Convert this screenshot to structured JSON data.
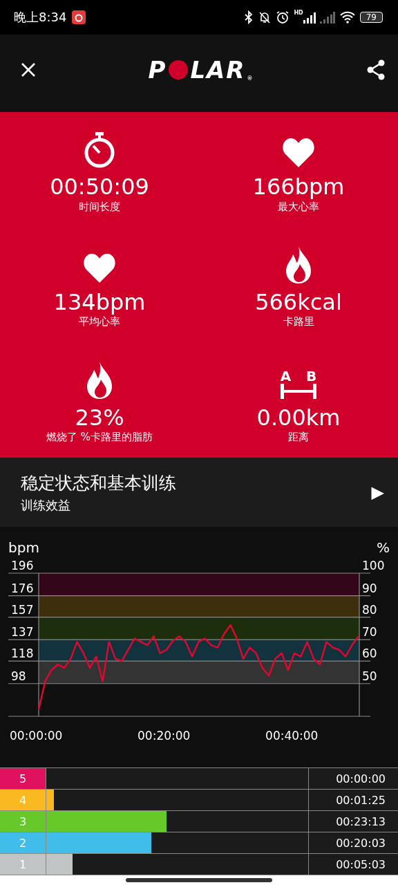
{
  "status_bar": {
    "time": "晚上8:34",
    "network": "HD",
    "battery": "79"
  },
  "header": {
    "logo": {
      "before": "P",
      "after": "LAR",
      "mark": "®"
    }
  },
  "stats": [
    {
      "kind": "stopwatch",
      "value": "00:50:09",
      "label": "时间长度"
    },
    {
      "kind": "heart",
      "value": "166bpm",
      "label": "最大心率"
    },
    {
      "kind": "heart",
      "value": "134bpm",
      "label": "平均心率"
    },
    {
      "kind": "flame",
      "value": "566kcal",
      "label": "卡路里"
    },
    {
      "kind": "flame",
      "value": "23%",
      "label": "燃烧了 %卡路里的脂肪"
    },
    {
      "kind": "distance",
      "value": "0.00km",
      "label": "距离"
    }
  ],
  "distance_icon": {
    "labels": [
      "A",
      "B"
    ]
  },
  "benefit": {
    "title": "稳定状态和基本训练",
    "subtitle": "训练效益",
    "play": "▶"
  },
  "heart_rate": {
    "right_unit": "%",
    "percent_ticks": [
      "100",
      "90",
      "80",
      "70",
      "60",
      "50"
    ],
    "chart_data": {
      "type": "line",
      "ylabel": "bpm",
      "ylim": [
        69,
        196
      ],
      "grid": true,
      "yticks": [
        196,
        176,
        157,
        137,
        118,
        98
      ],
      "xlim": [
        0,
        50.15
      ],
      "xticks": [
        {
          "value": 0,
          "label": "00:00:00"
        },
        {
          "value": 20,
          "label": "00:20:00"
        },
        {
          "value": 40,
          "label": "00:40:00"
        }
      ],
      "x": [
        0,
        1,
        2,
        3,
        4,
        5,
        6,
        7,
        8,
        9,
        10,
        11,
        12,
        13,
        14,
        15,
        16,
        17,
        18,
        19,
        20,
        21,
        22,
        23,
        24,
        25,
        26,
        27,
        28,
        29,
        30,
        31,
        32,
        33,
        34,
        35,
        36,
        37,
        38,
        39,
        40,
        41,
        42,
        43,
        44,
        45,
        46,
        47,
        48,
        49,
        50
      ],
      "series": [
        {
          "color": "#e3062f",
          "values": [
            75,
            100,
            110,
            115,
            112,
            120,
            135,
            125,
            112,
            122,
            100,
            135,
            120,
            118,
            128,
            138,
            135,
            132,
            140,
            125,
            128,
            136,
            140,
            135,
            122,
            135,
            138,
            132,
            130,
            142,
            150,
            138,
            120,
            130,
            125,
            112,
            105,
            120,
            125,
            110,
            125,
            122,
            135,
            120,
            115,
            135,
            130,
            128,
            122,
            132,
            140
          ]
        }
      ]
    }
  },
  "zones": [
    {
      "zone": "5",
      "color": "#e0115f",
      "time": "00:00:00"
    },
    {
      "zone": "4",
      "color": "#fbb921",
      "level": 0.03,
      "time": "00:01:25"
    },
    {
      "zone": "3",
      "color": "#67c82a",
      "level": 0.46,
      "time": "00:23:13"
    },
    {
      "zone": "2",
      "color": "#40bde8",
      "level": 0.4,
      "time": "00:20:03"
    },
    {
      "zone": "1",
      "color": "#c0c4c4",
      "level": 0.1,
      "time": "00:05:03"
    }
  ]
}
